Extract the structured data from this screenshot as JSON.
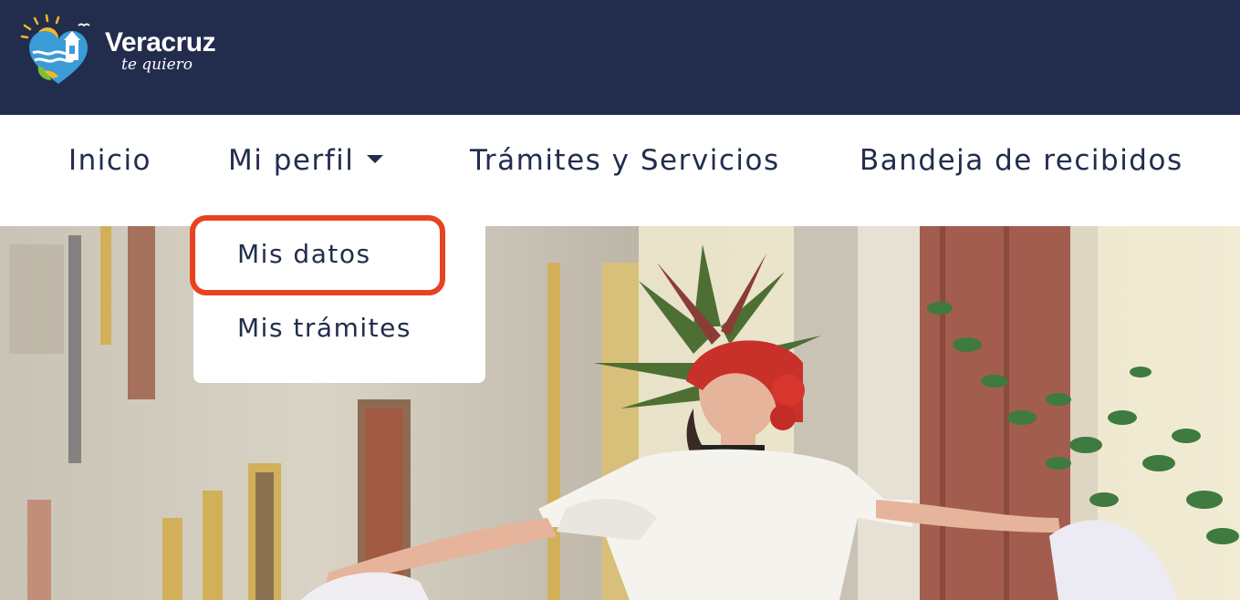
{
  "brand": {
    "name": "Veracruz",
    "tagline": "te quiero",
    "logo_icon": "veracruz-heart-logo",
    "colors": {
      "header_bg": "#222d4e",
      "nav_text": "#222d4e",
      "highlight": "#e8421f"
    }
  },
  "nav": {
    "items": [
      {
        "label": "Inicio"
      },
      {
        "label": "Mi perfil",
        "has_dropdown": true,
        "caret_icon": "caret-down-icon"
      },
      {
        "label": "Trámites y Servicios"
      },
      {
        "label": "Bandeja de recibidos"
      }
    ]
  },
  "dropdown": {
    "items": [
      {
        "label": "Mis datos",
        "highlighted": true
      },
      {
        "label": "Mis trámites"
      }
    ]
  }
}
